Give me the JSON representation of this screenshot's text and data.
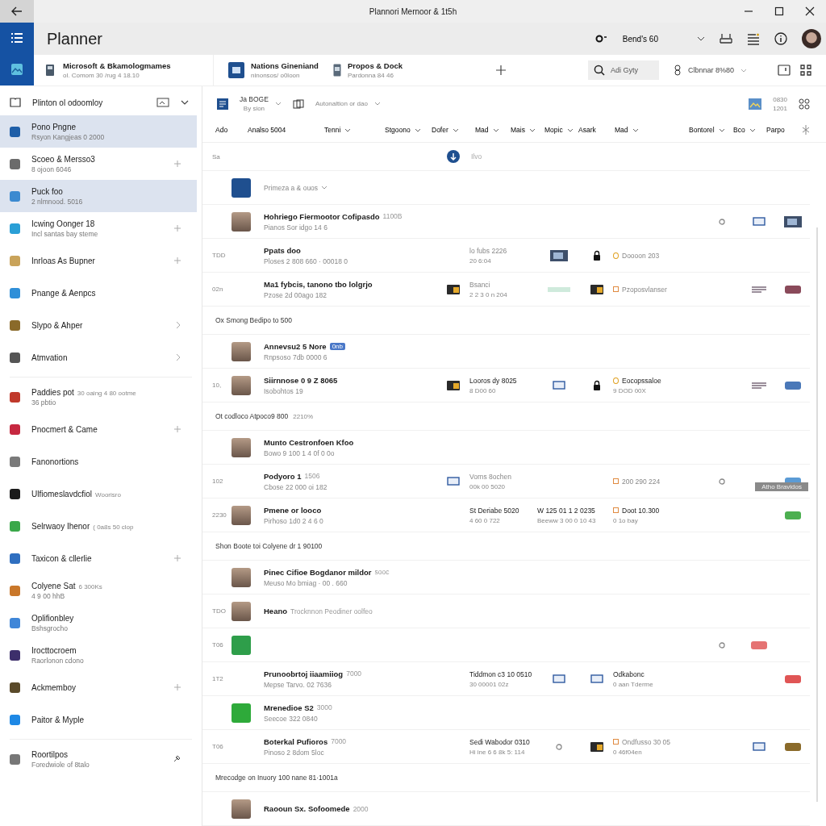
{
  "window": {
    "title": "Plannori Mernoor & 1t5h"
  },
  "app": {
    "name": "Planner"
  },
  "header": {
    "account": "Bend's 60"
  },
  "context": {
    "title": "Microsoft & Bkamologmames",
    "subtitle": "ol. Comom 30 /rug 4 18.10"
  },
  "boards": [
    {
      "kind": "board",
      "label": "Nations Gineniand",
      "sub": "ninonsos/ o0loon"
    },
    {
      "kind": "doc",
      "label": "Propos & Dock",
      "sub": "Pardonna 84 46"
    }
  ],
  "search": {
    "placeholder": "Adi Gyty"
  },
  "group_picker": {
    "label": "Clbnnar 8%80"
  },
  "toolbar": {
    "filter": {
      "label": "Ja BOGE",
      "sub": "By sion"
    },
    "view": {
      "label": "Autonaltion or dao"
    },
    "counter": {
      "label": "0830",
      "sub": "1201"
    }
  },
  "columns": [
    {
      "label": "Ado",
      "menu": false
    },
    {
      "label": "Analso 5004",
      "menu": false
    },
    {
      "label": "Tenni",
      "menu": true
    },
    {
      "label": "Stgoono",
      "menu": true
    },
    {
      "label": "Dofer",
      "menu": true
    },
    {
      "label": "Mad",
      "menu": true
    },
    {
      "label": "Mais",
      "menu": true
    },
    {
      "label": "Mopic",
      "menu": true
    },
    {
      "label": "Asark",
      "menu": false
    },
    {
      "label": "Mad",
      "menu": true
    },
    {
      "label": "Bontorel",
      "menu": true
    },
    {
      "label": "Bco",
      "menu": true
    },
    {
      "label": "Parpo",
      "menu": false
    }
  ],
  "sidebar": {
    "header": "Plinton ol odoomloy",
    "items": [
      {
        "kind": "plain",
        "label": "Pono Pngne",
        "sub": "Rsyon Kangjeas 0 2000",
        "selected": true,
        "color": "#1f5fa8"
      },
      {
        "kind": "plus",
        "label": "Scoeo & Mersso3",
        "sub": "8 ojoon 6046",
        "selected": false,
        "color": "#6b6b6b"
      },
      {
        "kind": "plain",
        "label": "Puck foo",
        "sub": "2 nlmnood. 5016",
        "selected": true,
        "color": "#3b8ad0"
      },
      {
        "kind": "plus",
        "label": "Icwing Oonger 18",
        "sub": "Incl santas bay steme",
        "selected": false,
        "color": "#2a9fd6"
      },
      {
        "kind": "plus",
        "label": "Inrloas As Bupner",
        "selected": false,
        "color": "#c9a35a"
      },
      {
        "kind": "plain",
        "label": "Pnange & Aenpcs",
        "selected": false,
        "color": "#2f8fd8"
      },
      {
        "kind": "chevron",
        "label": "Slypo & Ahper",
        "selected": false,
        "color": "#8a6a2a"
      },
      {
        "kind": "chevron",
        "label": "Atmvation",
        "selected": false,
        "color": "#555555",
        "divider": true
      },
      {
        "kind": "plain",
        "label": "Paddies pot",
        "note": "30 oaing 4 80 ootme",
        "sub": "36 pbtio",
        "selected": false,
        "color": "#c0392b"
      },
      {
        "kind": "plus",
        "label": "Pnocmert & Came",
        "selected": false,
        "color": "#c62840"
      },
      {
        "kind": "plain",
        "label": "Fanonortions",
        "selected": false,
        "color": "#7a7a7a"
      },
      {
        "kind": "plain",
        "label": "Ulfiomeslavdcfiol",
        "note": "Woorisro",
        "selected": false,
        "color": "#1a1a1a"
      },
      {
        "kind": "plain",
        "label": "Selrwaoy Ihenor",
        "note": "( 0a8s 50 clop",
        "selected": false,
        "color": "#3aa84a"
      },
      {
        "kind": "plus",
        "label": "Taxicon & cllerlie",
        "selected": false,
        "color": "#2f6fc0"
      },
      {
        "kind": "plain",
        "label": "Colyene Sat",
        "note": "6 300Ks",
        "sub": "4 9 00 hhB",
        "selected": false,
        "color": "#c9772a"
      },
      {
        "kind": "plain",
        "label": "Oplifionbley",
        "sub": "Bshsgrocho",
        "selected": false,
        "color": "#3f86d8"
      },
      {
        "kind": "plain",
        "label": "Irocttocroem",
        "sub": "Raorlonon cdono",
        "selected": false,
        "color": "#3d2f6b"
      },
      {
        "kind": "plus",
        "label": "Ackmemboy",
        "selected": false,
        "color": "#5a4a2a"
      },
      {
        "kind": "plain",
        "label": "Paitor & Myple",
        "selected": false,
        "color": "#1e88e5",
        "divider": true
      },
      {
        "kind": "pin",
        "label": "Roortilpos",
        "sub": "Foredwiole of 8talo",
        "selected": false,
        "color": "#777777"
      }
    ]
  },
  "rows": [
    {
      "kind": "add",
      "num": "Sa",
      "placeholder": "Ilvo"
    },
    {
      "kind": "picker",
      "avatar": {
        "kind": "app",
        "color": "#1f4f8f"
      },
      "label": "Primeza a & ouos"
    },
    {
      "kind": "task",
      "avatar": {
        "kind": "photo"
      },
      "title": "Hohriego Fiermootor Cofipasdo",
      "note": "1100B",
      "sub": "Pianos Sor idgo 14 6",
      "cells": [
        null,
        null,
        null,
        null,
        null,
        {
          "kind": "dot"
        },
        {
          "kind": "card"
        },
        {
          "kind": "photo"
        }
      ]
    },
    {
      "kind": "task",
      "num": "TDD",
      "title": "Ppats doo",
      "sub": "Ploses 2 808 660 · 00018 0",
      "cells": [
        null,
        {
          "kind": "text",
          "main": "lo fubs 2226",
          "sub": "20 6:04",
          "dim": true
        },
        {
          "kind": "photo"
        },
        {
          "kind": "lock"
        },
        {
          "kind": "ringtext",
          "main": "Doooon 203",
          "dim": true
        },
        null,
        null,
        null
      ]
    },
    {
      "kind": "task",
      "num": "02n",
      "title": "Ma1 fybcis, tanono tbo lolgrjo",
      "sub": "Pzose 2d 00ago 182",
      "cells": [
        {
          "kind": "chip"
        },
        {
          "kind": "text",
          "main": "Bsanci",
          "sub": "2 2 3 0 n 204",
          "dim": true
        },
        {
          "kind": "bar"
        },
        {
          "kind": "chip"
        },
        {
          "kind": "boxtext",
          "main": "Pzoposvlanser",
          "dim": true
        },
        null,
        {
          "kind": "lines"
        },
        {
          "kind": "tag",
          "color": "#8a4a5a"
        }
      ]
    },
    {
      "kind": "group",
      "label": "Ox Smong Bedipo to 500"
    },
    {
      "kind": "task",
      "avatar": {
        "kind": "photo"
      },
      "title": "Annevsu2 5 Nore",
      "badge": "0nb",
      "sub": "Rnpsoso 7db 0000 6"
    },
    {
      "kind": "task",
      "num": "10,",
      "avatar": {
        "kind": "photo"
      },
      "title": "Siirnnose 0 9 Z 8065",
      "sub": "Isobohtos 19",
      "cells": [
        {
          "kind": "chip"
        },
        {
          "kind": "text",
          "main": "Looros dy 8025",
          "sub": "8 D00 60",
          "dim": false
        },
        {
          "kind": "card"
        },
        {
          "kind": "lock"
        },
        {
          "kind": "ringtext",
          "main": "Eocopssaloe",
          "sub": "9 DOD 00X",
          "dim": false
        },
        null,
        {
          "kind": "lines"
        },
        {
          "kind": "tag",
          "color": "#4a78b8"
        }
      ]
    },
    {
      "kind": "group",
      "label": "Ot codloco Atpoco9 800",
      "note": "2210%"
    },
    {
      "kind": "task",
      "avatar": {
        "kind": "photo"
      },
      "title": "Munto Cestronfoen Kfoo",
      "sub": "Bowo 9 100 1 4 0f 0 0o"
    },
    {
      "kind": "task",
      "num": "102",
      "title": "Podyoro 1",
      "note": "1506",
      "sub": "Cbose 22 000 oi 182",
      "tooltip": "Atho Bravidos",
      "cells": [
        {
          "kind": "card"
        },
        {
          "kind": "text",
          "main": "Vorns 8ochen",
          "sub": "00k 00 5020",
          "dim": true
        },
        null,
        null,
        {
          "kind": "boxtext",
          "main": "200 290 224",
          "dim": true
        },
        {
          "kind": "dot"
        },
        null,
        {
          "kind": "tag",
          "color": "#5b9bd5"
        }
      ]
    },
    {
      "kind": "task",
      "num": "2230",
      "avatar": {
        "kind": "photo"
      },
      "title": "Pmene or looco",
      "sub": "Pirhoso 1d0 2 4 6 0",
      "cells": [
        null,
        {
          "kind": "text",
          "main": "St Deriabe 5020",
          "sub": "4 60 0 722",
          "dim": false
        },
        {
          "kind": "text",
          "main": "W 125 01 1 2 0235",
          "sub": "Beeww 3 00 0 10 43",
          "dim": false
        },
        null,
        {
          "kind": "boxtext",
          "main": "Doot 10.300",
          "sub": "0 1o bay",
          "dim": false
        },
        null,
        null,
        {
          "kind": "tag",
          "color": "#4caf50"
        }
      ]
    },
    {
      "kind": "group",
      "label": "Shon Boote toi Colyene dr 1 90100"
    },
    {
      "kind": "task",
      "avatar": {
        "kind": "photo"
      },
      "title": "Pinec Cifioe Bogdanor mildor",
      "note": "sooc",
      "sub": "Meuso Mo bmiag · 00 . 660"
    },
    {
      "kind": "task",
      "num": "TDO",
      "avatar": {
        "kind": "photo"
      },
      "title": "Heano",
      "note": "Trocknnon Peodiner oolfeo"
    },
    {
      "kind": "task",
      "num": "T06",
      "avatar": {
        "kind": "app",
        "color": "#2e9e4a"
      },
      "cells": [
        null,
        null,
        null,
        null,
        null,
        {
          "kind": "dot"
        },
        {
          "kind": "tag",
          "color": "#e57373"
        },
        null
      ]
    },
    {
      "kind": "task",
      "num": "1T2",
      "title": "Prunoobrtoj iiaamiiog",
      "note": "7000",
      "sub": "Mepse Tarvo. 02 7636",
      "cells": [
        null,
        {
          "kind": "text",
          "main": "Tiddmon c3 10 0510",
          "sub": "30 00001 02z",
          "dim": false
        },
        {
          "kind": "card"
        },
        {
          "kind": "card"
        },
        {
          "kind": "text",
          "main": "Odkabonc",
          "sub": "0 aan Tderme",
          "dim": false
        },
        null,
        null,
        {
          "kind": "tag",
          "color": "#e05555"
        }
      ]
    },
    {
      "kind": "task",
      "avatar": {
        "kind": "app",
        "color": "#2eaa3a"
      },
      "title": "Mrenedioe S2",
      "note": "3000",
      "sub": "Seecoe 322 0840"
    },
    {
      "kind": "task",
      "num": "T06",
      "title": "Boterkal Pufioros",
      "note": "7000",
      "sub": "Pinoso 2 8dom 5loc",
      "cells": [
        null,
        {
          "kind": "text",
          "main": "Sedi Wabodor 0310",
          "sub": "Hi ine 6 6 8k 5: 114",
          "dim": false
        },
        {
          "kind": "dot"
        },
        {
          "kind": "chip"
        },
        {
          "kind": "boxtext",
          "main": "Ondfusso 30 05",
          "sub": "0 46f04en",
          "dim": true
        },
        null,
        {
          "kind": "card"
        },
        {
          "kind": "tag",
          "color": "#8a6a2a"
        }
      ]
    },
    {
      "kind": "group",
      "label": "Mrecodge on Inuory 100 nane 81·1001a"
    },
    {
      "kind": "task",
      "avatar": {
        "kind": "photo"
      },
      "title": "Raooun Sx. Sofoomede",
      "note": "2000"
    }
  ]
}
